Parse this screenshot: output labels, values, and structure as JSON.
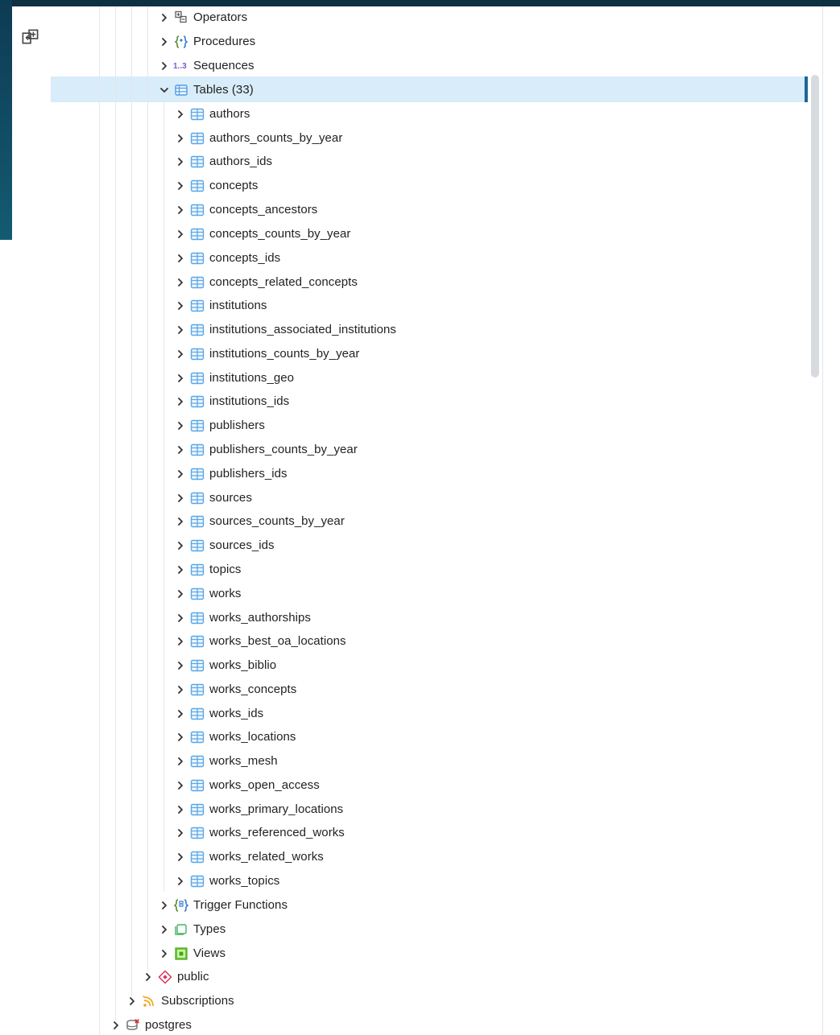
{
  "tree": {
    "schema_items_top": [
      {
        "label": "Operators",
        "icon": "operators-icon"
      },
      {
        "label": "Procedures",
        "icon": "procedures-icon"
      },
      {
        "label": "Sequences",
        "icon": "sequences-icon",
        "icon_text": "1..3"
      }
    ],
    "tables_node": {
      "label": "Tables (33)",
      "icon": "tables-folder-icon"
    },
    "tables": [
      "authors",
      "authors_counts_by_year",
      "authors_ids",
      "concepts",
      "concepts_ancestors",
      "concepts_counts_by_year",
      "concepts_ids",
      "concepts_related_concepts",
      "institutions",
      "institutions_associated_institutions",
      "institutions_counts_by_year",
      "institutions_geo",
      "institutions_ids",
      "publishers",
      "publishers_counts_by_year",
      "publishers_ids",
      "sources",
      "sources_counts_by_year",
      "sources_ids",
      "topics",
      "works",
      "works_authorships",
      "works_best_oa_locations",
      "works_biblio",
      "works_concepts",
      "works_ids",
      "works_locations",
      "works_mesh",
      "works_open_access",
      "works_primary_locations",
      "works_referenced_works",
      "works_related_works",
      "works_topics"
    ],
    "schema_items_bottom": [
      {
        "label": "Trigger Functions",
        "icon": "trigger-functions-icon"
      },
      {
        "label": "Types",
        "icon": "types-icon"
      },
      {
        "label": "Views",
        "icon": "views-icon"
      }
    ],
    "schema_nodes": [
      {
        "label": "public",
        "icon": "schema-icon"
      }
    ],
    "database_children": [
      {
        "label": "Subscriptions",
        "icon": "subscriptions-icon"
      }
    ],
    "databases": [
      {
        "label": "postgres",
        "icon": "database-icon"
      }
    ]
  },
  "colors": {
    "selection_bg": "#d8ecf9",
    "selection_accent": "#1d6697",
    "table_icon": "#5ba7e7",
    "header_bg": "#0f2f43"
  }
}
